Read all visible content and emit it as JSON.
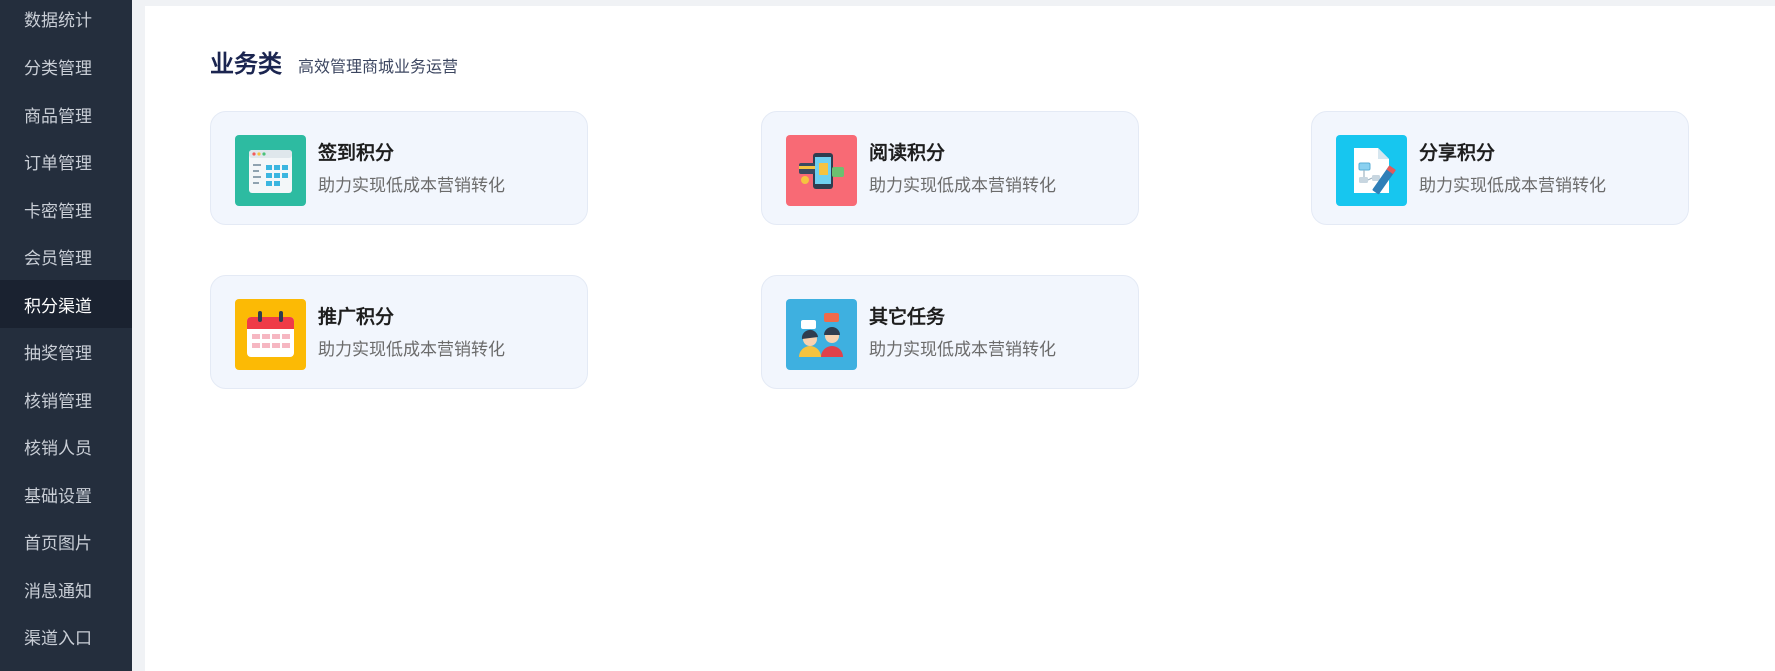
{
  "sidebar": {
    "items": [
      {
        "label": "数据统计",
        "active": false
      },
      {
        "label": "分类管理",
        "active": false
      },
      {
        "label": "商品管理",
        "active": false
      },
      {
        "label": "订单管理",
        "active": false
      },
      {
        "label": "卡密管理",
        "active": false
      },
      {
        "label": "会员管理",
        "active": false
      },
      {
        "label": "积分渠道",
        "active": true
      },
      {
        "label": "抽奖管理",
        "active": false
      },
      {
        "label": "核销管理",
        "active": false
      },
      {
        "label": "核销人员",
        "active": false
      },
      {
        "label": "基础设置",
        "active": false
      },
      {
        "label": "首页图片",
        "active": false
      },
      {
        "label": "消息通知",
        "active": false
      },
      {
        "label": "渠道入口",
        "active": false
      }
    ]
  },
  "section": {
    "title": "业务类",
    "subtitle": "高效管理商城业务运营"
  },
  "cards": [
    {
      "title": "签到积分",
      "desc": "助力实现低成本营销转化",
      "icon": "calendar-grid-icon",
      "icon_color": "#2dbba1"
    },
    {
      "title": "阅读积分",
      "desc": "助力实现低成本营销转化",
      "icon": "phone-payment-icon",
      "icon_color": "#f86a75"
    },
    {
      "title": "分享积分",
      "desc": "助力实现低成本营销转化",
      "icon": "document-pen-icon",
      "icon_color": "#17c6ef"
    },
    {
      "title": "推广积分",
      "desc": "助力实现低成本营销转化",
      "icon": "calendar-icon",
      "icon_color": "#fcba05"
    },
    {
      "title": "其它任务",
      "desc": "助力实现低成本营销转化",
      "icon": "people-chat-icon",
      "icon_color": "#3eb0e0"
    }
  ],
  "colors": {
    "sidebar_bg": "#242e3d",
    "sidebar_active_bg": "#1a2230",
    "card_bg": "#f2f6fd",
    "title_color": "#1b2550"
  }
}
